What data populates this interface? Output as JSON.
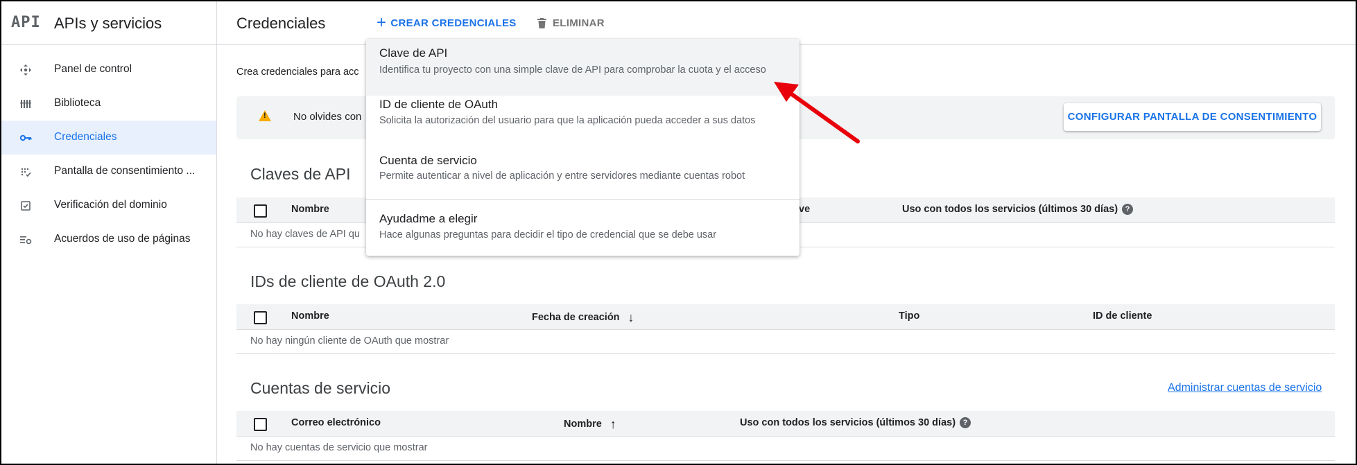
{
  "app": {
    "logo": "API",
    "title": "APIs y servicios"
  },
  "sidebar": {
    "items": [
      {
        "label": "Panel de control",
        "icon": "dashboard-icon"
      },
      {
        "label": "Biblioteca",
        "icon": "library-icon"
      },
      {
        "label": "Credenciales",
        "icon": "key-icon",
        "active": true
      },
      {
        "label": "Pantalla de consentimiento ...",
        "icon": "consent-icon"
      },
      {
        "label": "Verificación del dominio",
        "icon": "domain-check-icon"
      },
      {
        "label": "Acuerdos de uso de páginas",
        "icon": "settings-list-icon"
      }
    ]
  },
  "header": {
    "title": "Credenciales",
    "create_label": "CREAR CREDENCIALES",
    "delete_label": "ELIMINAR"
  },
  "main": {
    "intro": "Crea credenciales para acc",
    "warning_text": "No olvides con",
    "consent_button": "CONFIGURAR PANTALLA DE CONSENTIMIENTO",
    "api_keys": {
      "title": "Claves de API",
      "columns": [
        "Nombre",
        "ve",
        "Uso con todos los servicios (últimos 30 días)"
      ],
      "empty": "No hay claves de API qu"
    },
    "oauth": {
      "title": "IDs de cliente de OAuth 2.0",
      "columns": [
        "Nombre",
        "Fecha de creación",
        "Tipo",
        "ID de cliente"
      ],
      "empty": "No hay ningún cliente de OAuth que mostrar"
    },
    "service_accounts": {
      "title": "Cuentas de servicio",
      "admin_link": "Administrar cuentas de servicio",
      "columns": [
        "Correo electrónico",
        "Nombre",
        "Uso con todos los servicios (últimos 30 días)"
      ],
      "empty": "No hay cuentas de servicio que mostrar"
    }
  },
  "menu": {
    "items": [
      {
        "title": "Clave de API",
        "desc": "Identifica tu proyecto con una simple clave de API para comprobar la cuota y el acceso"
      },
      {
        "title": "ID de cliente de OAuth",
        "desc": "Solicita la autorización del usuario para que la aplicación pueda acceder a sus datos"
      },
      {
        "title": "Cuenta de servicio",
        "desc": "Permite autenticar a nivel de aplicación y entre servidores mediante cuentas robot"
      },
      {
        "title": "Ayudadme a elegir",
        "desc": "Hace algunas preguntas para decidir el tipo de credencial que se debe usar"
      }
    ]
  },
  "colors": {
    "accent": "#1a73e8",
    "annotation_arrow": "#e8000b",
    "warning": "#f9ab00"
  }
}
